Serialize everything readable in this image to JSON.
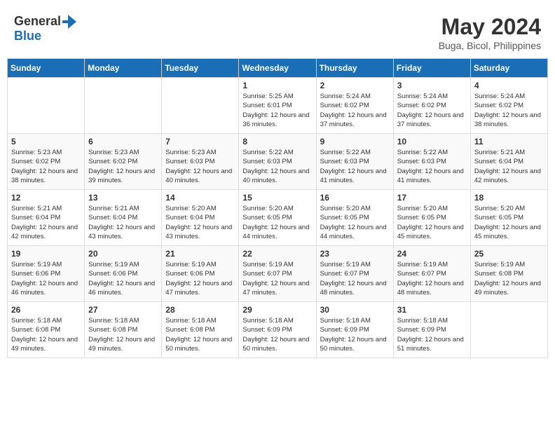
{
  "header": {
    "logo_general": "General",
    "logo_blue": "Blue",
    "month_year": "May 2024",
    "location": "Buga, Bicol, Philippines"
  },
  "weekdays": [
    "Sunday",
    "Monday",
    "Tuesday",
    "Wednesday",
    "Thursday",
    "Friday",
    "Saturday"
  ],
  "weeks": [
    [
      {
        "day": "",
        "sunrise": "",
        "sunset": "",
        "daylight": ""
      },
      {
        "day": "",
        "sunrise": "",
        "sunset": "",
        "daylight": ""
      },
      {
        "day": "",
        "sunrise": "",
        "sunset": "",
        "daylight": ""
      },
      {
        "day": "1",
        "sunrise": "5:25 AM",
        "sunset": "6:01 PM",
        "daylight": "12 hours and 36 minutes."
      },
      {
        "day": "2",
        "sunrise": "5:24 AM",
        "sunset": "6:02 PM",
        "daylight": "12 hours and 37 minutes."
      },
      {
        "day": "3",
        "sunrise": "5:24 AM",
        "sunset": "6:02 PM",
        "daylight": "12 hours and 37 minutes."
      },
      {
        "day": "4",
        "sunrise": "5:24 AM",
        "sunset": "6:02 PM",
        "daylight": "12 hours and 38 minutes."
      }
    ],
    [
      {
        "day": "5",
        "sunrise": "5:23 AM",
        "sunset": "6:02 PM",
        "daylight": "12 hours and 38 minutes."
      },
      {
        "day": "6",
        "sunrise": "5:23 AM",
        "sunset": "6:02 PM",
        "daylight": "12 hours and 39 minutes."
      },
      {
        "day": "7",
        "sunrise": "5:23 AM",
        "sunset": "6:03 PM",
        "daylight": "12 hours and 40 minutes."
      },
      {
        "day": "8",
        "sunrise": "5:22 AM",
        "sunset": "6:03 PM",
        "daylight": "12 hours and 40 minutes."
      },
      {
        "day": "9",
        "sunrise": "5:22 AM",
        "sunset": "6:03 PM",
        "daylight": "12 hours and 41 minutes."
      },
      {
        "day": "10",
        "sunrise": "5:22 AM",
        "sunset": "6:03 PM",
        "daylight": "12 hours and 41 minutes."
      },
      {
        "day": "11",
        "sunrise": "5:21 AM",
        "sunset": "6:04 PM",
        "daylight": "12 hours and 42 minutes."
      }
    ],
    [
      {
        "day": "12",
        "sunrise": "5:21 AM",
        "sunset": "6:04 PM",
        "daylight": "12 hours and 42 minutes."
      },
      {
        "day": "13",
        "sunrise": "5:21 AM",
        "sunset": "6:04 PM",
        "daylight": "12 hours and 43 minutes."
      },
      {
        "day": "14",
        "sunrise": "5:20 AM",
        "sunset": "6:04 PM",
        "daylight": "12 hours and 43 minutes."
      },
      {
        "day": "15",
        "sunrise": "5:20 AM",
        "sunset": "6:05 PM",
        "daylight": "12 hours and 44 minutes."
      },
      {
        "day": "16",
        "sunrise": "5:20 AM",
        "sunset": "6:05 PM",
        "daylight": "12 hours and 44 minutes."
      },
      {
        "day": "17",
        "sunrise": "5:20 AM",
        "sunset": "6:05 PM",
        "daylight": "12 hours and 45 minutes."
      },
      {
        "day": "18",
        "sunrise": "5:20 AM",
        "sunset": "6:05 PM",
        "daylight": "12 hours and 45 minutes."
      }
    ],
    [
      {
        "day": "19",
        "sunrise": "5:19 AM",
        "sunset": "6:06 PM",
        "daylight": "12 hours and 46 minutes."
      },
      {
        "day": "20",
        "sunrise": "5:19 AM",
        "sunset": "6:06 PM",
        "daylight": "12 hours and 46 minutes."
      },
      {
        "day": "21",
        "sunrise": "5:19 AM",
        "sunset": "6:06 PM",
        "daylight": "12 hours and 47 minutes."
      },
      {
        "day": "22",
        "sunrise": "5:19 AM",
        "sunset": "6:07 PM",
        "daylight": "12 hours and 47 minutes."
      },
      {
        "day": "23",
        "sunrise": "5:19 AM",
        "sunset": "6:07 PM",
        "daylight": "12 hours and 48 minutes."
      },
      {
        "day": "24",
        "sunrise": "5:19 AM",
        "sunset": "6:07 PM",
        "daylight": "12 hours and 48 minutes."
      },
      {
        "day": "25",
        "sunrise": "5:19 AM",
        "sunset": "6:08 PM",
        "daylight": "12 hours and 49 minutes."
      }
    ],
    [
      {
        "day": "26",
        "sunrise": "5:18 AM",
        "sunset": "6:08 PM",
        "daylight": "12 hours and 49 minutes."
      },
      {
        "day": "27",
        "sunrise": "5:18 AM",
        "sunset": "6:08 PM",
        "daylight": "12 hours and 49 minutes."
      },
      {
        "day": "28",
        "sunrise": "5:18 AM",
        "sunset": "6:08 PM",
        "daylight": "12 hours and 50 minutes."
      },
      {
        "day": "29",
        "sunrise": "5:18 AM",
        "sunset": "6:09 PM",
        "daylight": "12 hours and 50 minutes."
      },
      {
        "day": "30",
        "sunrise": "5:18 AM",
        "sunset": "6:09 PM",
        "daylight": "12 hours and 50 minutes."
      },
      {
        "day": "31",
        "sunrise": "5:18 AM",
        "sunset": "6:09 PM",
        "daylight": "12 hours and 51 minutes."
      },
      {
        "day": "",
        "sunrise": "",
        "sunset": "",
        "daylight": ""
      }
    ]
  ]
}
